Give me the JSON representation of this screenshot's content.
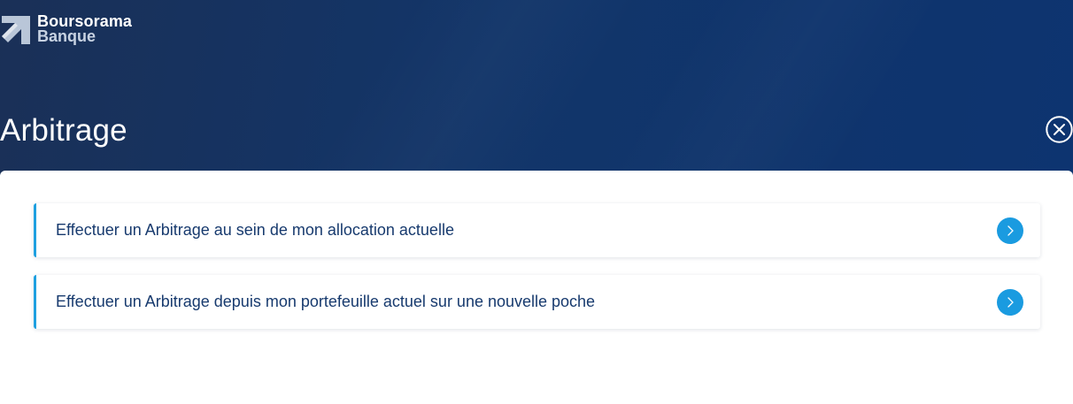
{
  "brand": {
    "name_line1": "Boursorama",
    "name_line2": "Banque",
    "logo_icon": "arrow-logo-icon"
  },
  "header": {
    "title": "Arbitrage",
    "close_icon": "close-circle-icon"
  },
  "options": [
    {
      "label": "Effectuer un Arbitrage au sein de mon allocation actuelle",
      "icon": "chevron-right-icon"
    },
    {
      "label": "Effectuer un Arbitrage depuis mon portefeuille actuel sur une nouvelle poche",
      "icon": "chevron-right-icon"
    }
  ],
  "colors": {
    "header_background": "#123569",
    "accent": "#1a9be0",
    "option_text": "#173a6e",
    "card_border": "#1ea0e0"
  }
}
